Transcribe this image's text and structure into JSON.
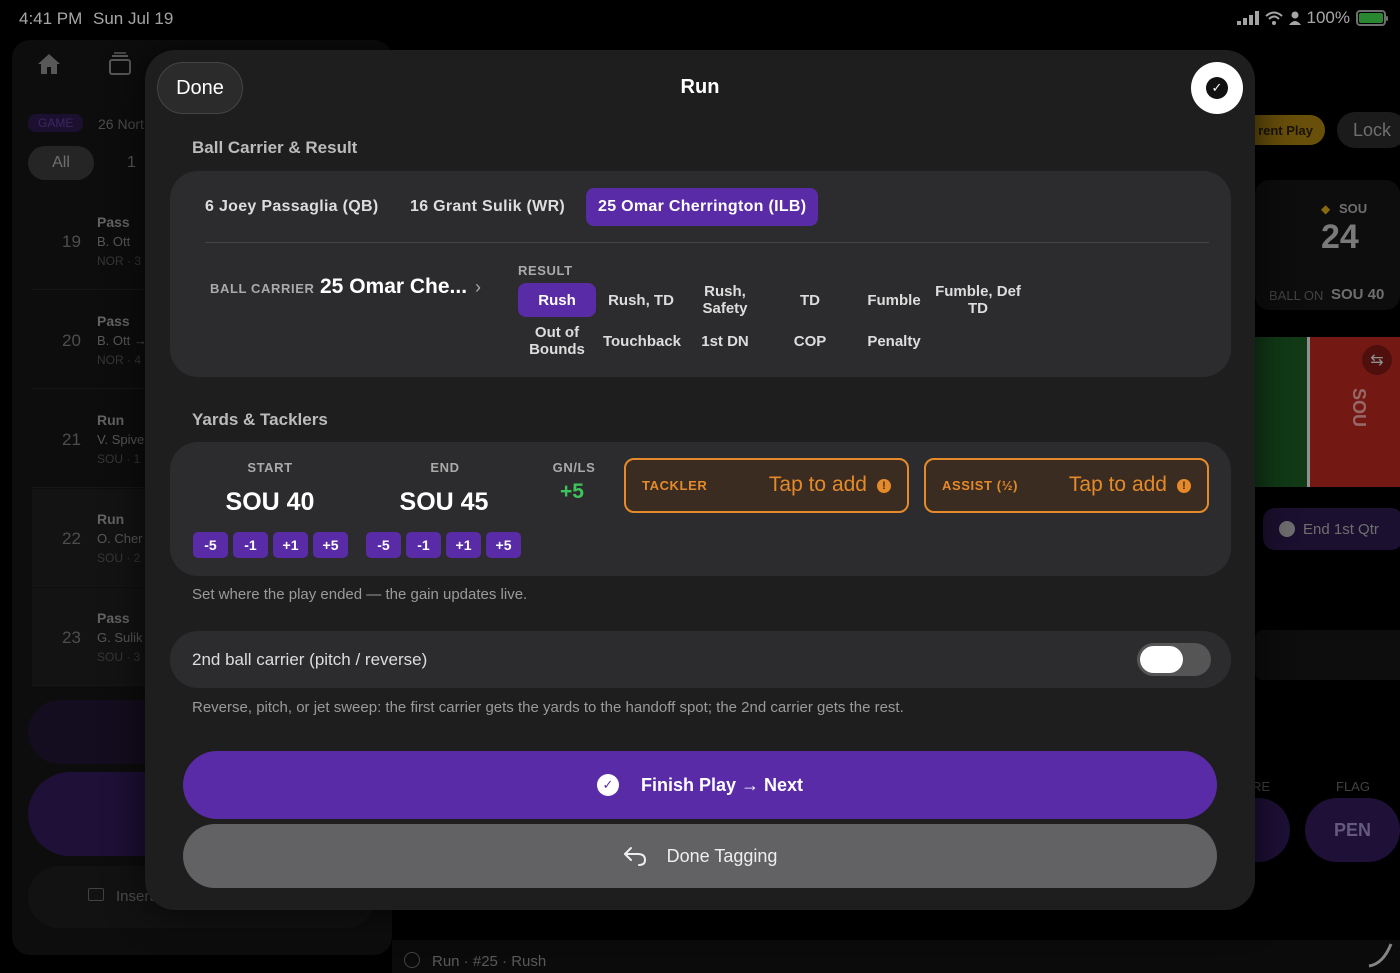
{
  "status": {
    "time": "4:41 PM",
    "date": "Sun Jul 19",
    "battery": "100%"
  },
  "background": {
    "game_tag": "GAME",
    "game_title": "26 Nort",
    "filter_all": "All",
    "filter_1": "1",
    "plays": [
      {
        "num": "19",
        "type": "Pass",
        "player": "B. Ott",
        "meta": "NOR · 3"
      },
      {
        "num": "20",
        "type": "Pass",
        "player": "B. Ott →",
        "meta": "NOR · 4"
      },
      {
        "num": "21",
        "type": "Run",
        "player": "V. Spive",
        "meta": "SOU · 1"
      },
      {
        "num": "22",
        "type": "Run",
        "player": "O. Cher",
        "meta": "SOU · 2"
      },
      {
        "num": "23",
        "type": "Pass",
        "player": "G. Sulik",
        "meta": "SOU · 3"
      }
    ],
    "insert": "Insert",
    "current_play": "rent Play",
    "lock": "Lock",
    "team": "SOU",
    "score": "24",
    "ball_on_label": "BALL ON",
    "ball_on_value": "SOU 40",
    "field_team": "SOU",
    "end_quarter": "End 1st Qtr",
    "flag_label": "FLAG",
    "flag_btn": "PEN",
    "re_label": "RE",
    "footer": "Run · #25 · Rush"
  },
  "modal": {
    "done": "Done",
    "title": "Run",
    "ball_carrier_section": "Ball Carrier & Result",
    "carriers": [
      {
        "label": "6  Joey Passaglia  (QB)",
        "selected": false
      },
      {
        "label": "16  Grant Sulik  (WR)",
        "selected": false
      },
      {
        "label": "25  Omar Cherrington  (ILB)",
        "selected": true
      }
    ],
    "ball_carrier_label": "BALL CARRIER",
    "ball_carrier_value": "25  Omar Che...",
    "result_label": "RESULT",
    "results_row1": [
      {
        "label": "Rush",
        "selected": true
      },
      {
        "label": "Rush, TD",
        "selected": false
      },
      {
        "label": "Rush, Safety",
        "selected": false
      },
      {
        "label": "TD",
        "selected": false
      },
      {
        "label": "Fumble",
        "selected": false
      },
      {
        "label": "Fumble, Def TD",
        "selected": false
      }
    ],
    "results_row2": [
      {
        "label": "Out of Bounds"
      },
      {
        "label": "Touchback"
      },
      {
        "label": "1st DN"
      },
      {
        "label": "COP"
      },
      {
        "label": "Penalty"
      }
    ],
    "yards_section": "Yards & Tacklers",
    "start_label": "START",
    "start_value": "SOU 40",
    "end_label": "END",
    "end_value": "SOU 45",
    "gnls_label": "GN/LS",
    "gnls_value": "+5",
    "steps": [
      "-5",
      "-1",
      "+1",
      "+5"
    ],
    "tackler_label": "TACKLER",
    "assist_label": "ASSIST (½)",
    "tap_to_add": "Tap to add",
    "yards_hint": "Set where the play ended — the gain updates live.",
    "second_carrier_label": "2nd ball carrier (pitch / reverse)",
    "second_carrier_on": false,
    "second_carrier_hint": "Reverse, pitch, or jet sweep: the first carrier gets the yards to the handoff spot; the 2nd carrier gets the rest.",
    "finish_btn": "Finish Play → Next",
    "done_tagging_btn": "Done Tagging"
  },
  "colors": {
    "accent": "#5a2ba6",
    "warn": "#e58a2a",
    "gain": "#3ec35a"
  }
}
